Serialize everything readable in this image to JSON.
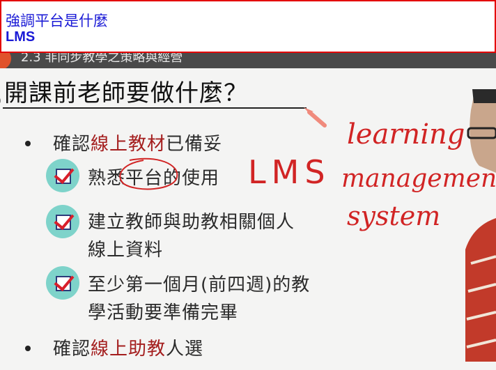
{
  "caption": {
    "line1": "強調平台是什麼",
    "line2": "LMS"
  },
  "video": {
    "title": "2.3 非同步教學之策略與經營"
  },
  "slide": {
    "title": "開課前老師要做什麼？",
    "bullet1": {
      "prefix": "確認",
      "highlight": "線上教材",
      "suffix": "已備妥"
    },
    "checks": [
      {
        "lines": [
          "熟悉平台的使用"
        ]
      },
      {
        "lines": [
          "建立教師與助教相關個人",
          "線上資料"
        ]
      },
      {
        "lines": [
          "至少第一個月(前四週)的教",
          "學活動要準備完畢"
        ]
      }
    ],
    "bullet2": {
      "prefix": "確認",
      "highlight": "線上助教",
      "suffix": "人選"
    }
  },
  "annotations": {
    "lms": "LMS",
    "word1": "learning",
    "word2": "management",
    "word3": "system"
  },
  "colors": {
    "caption_border": "#e30000",
    "caption_text": "#1a1ad6",
    "highlight": "#a41e1e",
    "annotation": "#d12424",
    "check_bg": "#7ed3ca"
  }
}
